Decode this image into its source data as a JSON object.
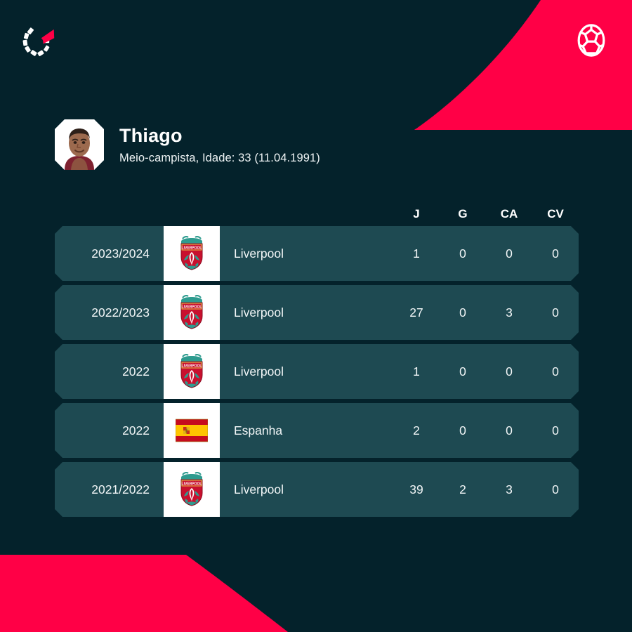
{
  "brand": {
    "logo_icon": "onefootball-speedometer-logo",
    "ball_icon": "soccer-ball-icon"
  },
  "colors": {
    "background": "#04222B",
    "accent_red": "#FF0046",
    "row_background": "#1E4A52",
    "text_primary": "#FFFFFF"
  },
  "player": {
    "name": "Thiago",
    "meta": "Meio-campista, Idade: 33 (11.04.1991)",
    "avatar_icon": "player-portrait"
  },
  "table": {
    "headers": [
      "J",
      "G",
      "CA",
      "CV"
    ],
    "rows": [
      {
        "season": "2023/2024",
        "team": "Liverpool",
        "badge": "liverpool-crest",
        "J": "1",
        "G": "0",
        "CA": "0",
        "CV": "0"
      },
      {
        "season": "2022/2023",
        "team": "Liverpool",
        "badge": "liverpool-crest",
        "J": "27",
        "G": "0",
        "CA": "3",
        "CV": "0"
      },
      {
        "season": "2022",
        "team": "Liverpool",
        "badge": "liverpool-crest",
        "J": "1",
        "G": "0",
        "CA": "0",
        "CV": "0"
      },
      {
        "season": "2022",
        "team": "Espanha",
        "badge": "spain-flag",
        "J": "2",
        "G": "0",
        "CA": "0",
        "CV": "0"
      },
      {
        "season": "2021/2022",
        "team": "Liverpool",
        "badge": "liverpool-crest",
        "J": "39",
        "G": "2",
        "CA": "3",
        "CV": "0"
      }
    ]
  }
}
